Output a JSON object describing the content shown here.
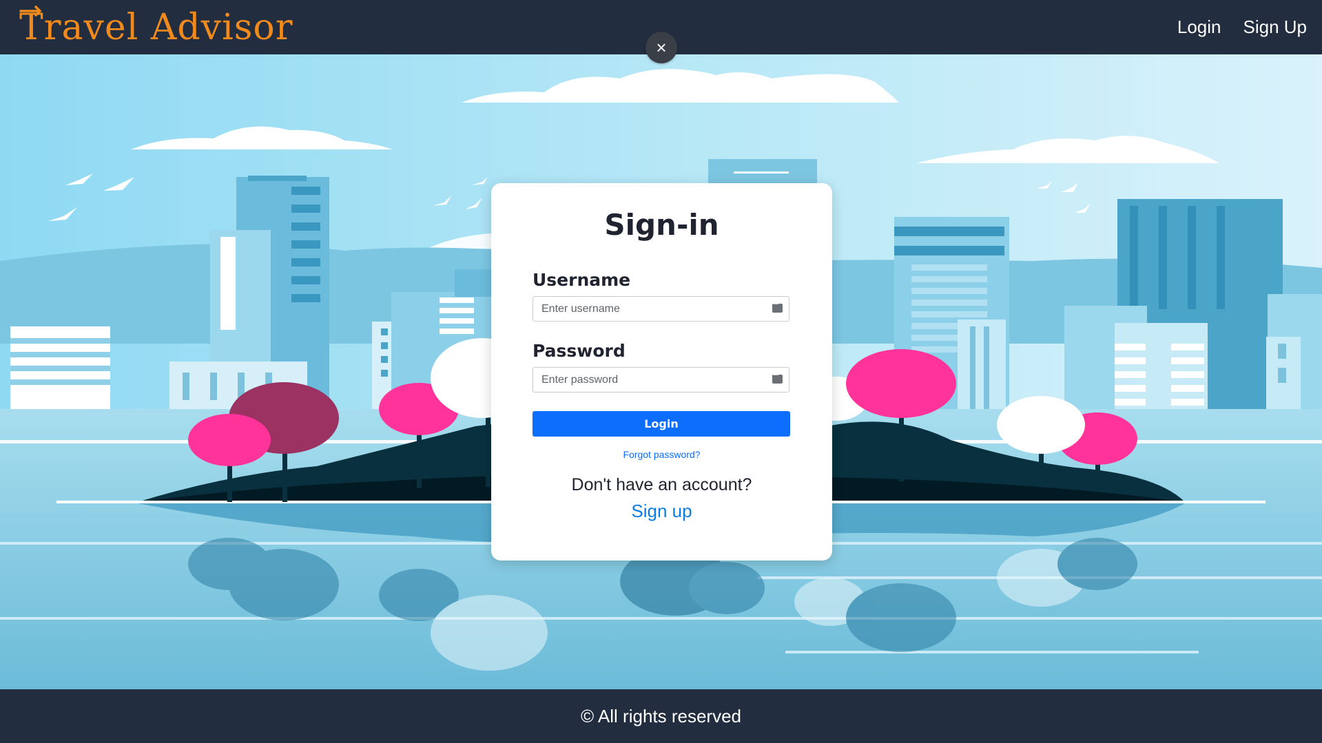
{
  "brand": {
    "name": "Travel Advisor",
    "color": "#f08a1c"
  },
  "nav": {
    "login": "Login",
    "signup": "Sign Up"
  },
  "modal": {
    "close_icon": "×",
    "title": "Sign-in",
    "username_label": "Username",
    "username_placeholder": "Enter username",
    "password_label": "Password",
    "password_placeholder": "Enter password",
    "login_button": "Login",
    "forgot_password": "Forgot password?",
    "no_account": "Don't have an account?",
    "signup_link": "Sign up"
  },
  "footer": {
    "text": "© All rights reserved"
  },
  "colors": {
    "navbar_bg": "#222d40",
    "primary_button": "#0d6efd",
    "sky": "#a6e1f4",
    "tree_pink": "#ff3399",
    "tree_maroon": "#9b3262",
    "island_dark": "#0a2a3a"
  }
}
